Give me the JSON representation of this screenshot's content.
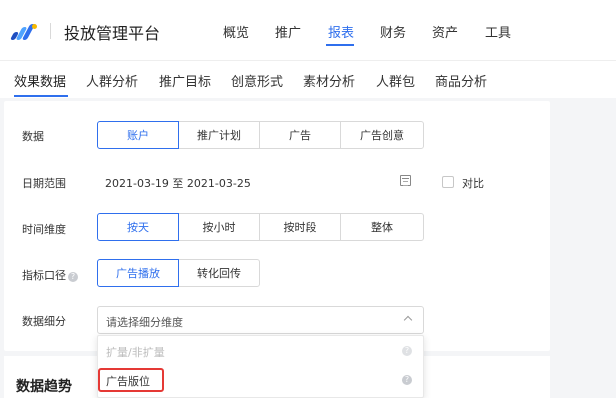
{
  "header": {
    "brand": "投放管理平台",
    "nav": [
      "概览",
      "推广",
      "报表",
      "财务",
      "资产",
      "工具"
    ],
    "active_nav": "报表",
    "colors": {
      "accent": "#2f6fed",
      "logo_dark": "#1f4fc1",
      "logo_light": "#4fa3ff",
      "logo_yellow": "#f5b800"
    }
  },
  "subnav": {
    "tabs": [
      "效果数据",
      "人群分析",
      "推广目标",
      "创意形式",
      "素材分析",
      "人群包",
      "商品分析"
    ],
    "active": "效果数据"
  },
  "filters": {
    "data": {
      "label": "数据",
      "options": [
        "账户",
        "推广计划",
        "广告",
        "广告创意"
      ],
      "selected": "账户"
    },
    "date": {
      "label": "日期范围",
      "value": "2021-03-19 至 2021-03-25",
      "icon": "calendar-icon",
      "compare_label": "对比",
      "compare_checked": false
    },
    "time": {
      "label": "时间维度",
      "options": [
        "按天",
        "按小时",
        "按时段",
        "整体"
      ],
      "selected": "按天"
    },
    "metric": {
      "label": "指标口径",
      "help_icon": "question-icon",
      "options": [
        "广告播放",
        "转化回传"
      ],
      "selected": "广告播放"
    },
    "breakdown": {
      "label": "数据细分",
      "placeholder": "请选择细分维度",
      "icon": "chevron-up-icon"
    }
  },
  "dropdown": {
    "items": [
      {
        "label": "扩量/非扩量",
        "disabled": true,
        "icon": "question-icon"
      },
      {
        "label": "广告版位",
        "disabled": false,
        "highlighted": true,
        "icon": "question-icon",
        "highlight_color": "#e53935"
      }
    ]
  },
  "trend": {
    "title": "数据趋势"
  }
}
